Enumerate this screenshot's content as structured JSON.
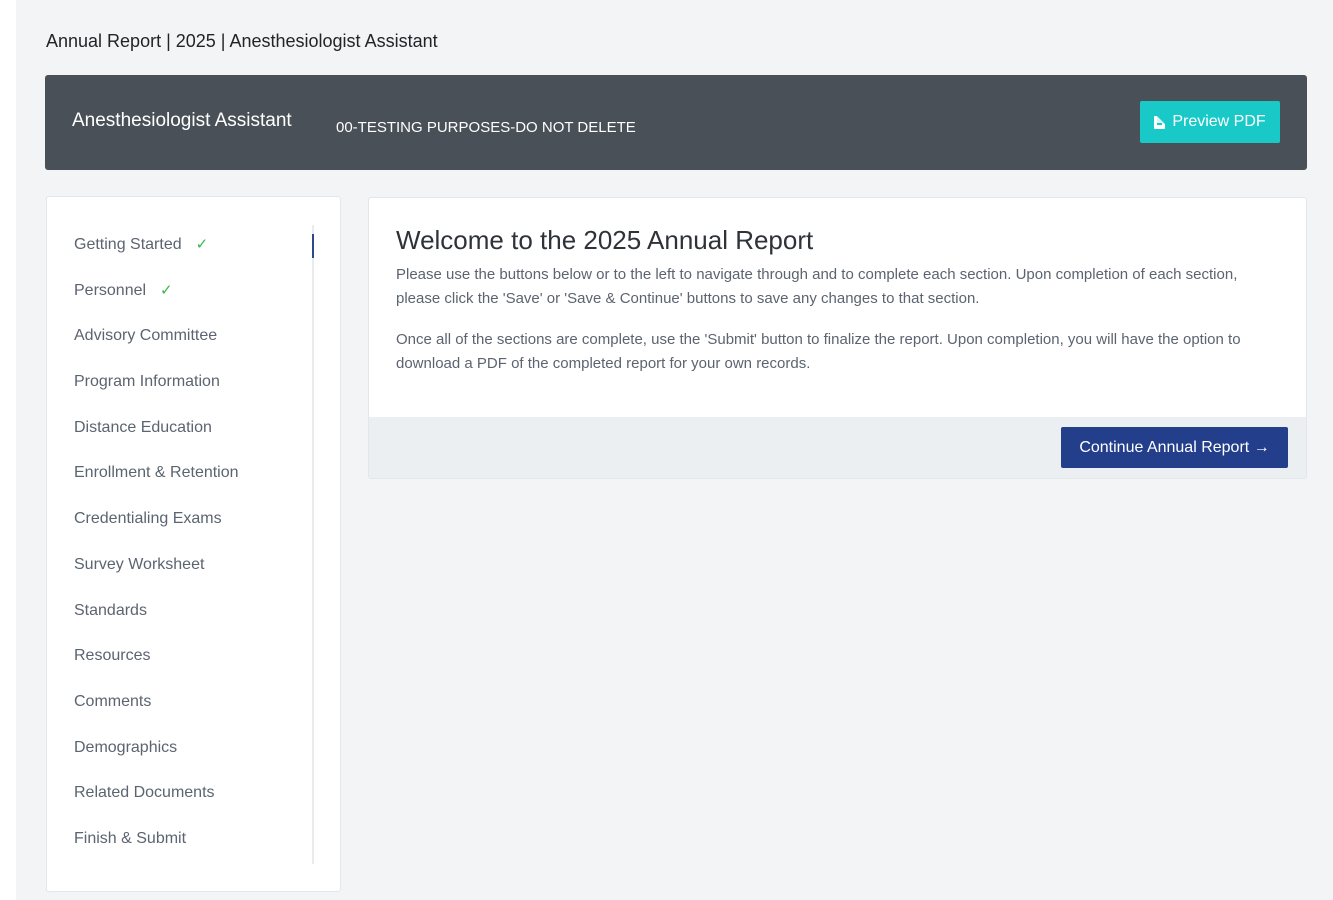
{
  "page": {
    "heading": "Annual Report | 2025 | Anesthesiologist Assistant"
  },
  "program_bar": {
    "name": "Anesthesiologist Assistant",
    "subtitle": "00-TESTING PURPOSES-DO NOT DELETE",
    "preview_button": "Preview PDF",
    "preview_icon": "file-pdf-icon",
    "background_color": "#495057",
    "button_color": "#19c9c7"
  },
  "sidebar": {
    "items": [
      {
        "label": "Getting Started",
        "completed": "✓",
        "active": true
      },
      {
        "label": "Personnel",
        "completed": "✓"
      },
      {
        "label": "Advisory Committee"
      },
      {
        "label": "Program Information"
      },
      {
        "label": "Distance Education"
      },
      {
        "label": "Enrollment & Retention"
      },
      {
        "label": "Credentialing Exams"
      },
      {
        "label": "Survey Worksheet"
      },
      {
        "label": "Standards"
      },
      {
        "label": "Resources"
      },
      {
        "label": "Comments"
      },
      {
        "label": "Demographics"
      },
      {
        "label": "Related Documents"
      },
      {
        "label": "Finish & Submit"
      }
    ],
    "check_color": "#39b54a",
    "active_color": "#2c4a86"
  },
  "welcome_card": {
    "title": "Welcome to the 2025 Annual Report",
    "paragraph_1": "Please use the buttons below or to the left to navigate through and to complete each section. Upon completion of each section, please click the 'Save' or 'Save & Continue' buttons to save any changes to that section.",
    "paragraph_2": "Once all of the sections are complete, use the 'Submit' button to finalize the report. Upon completion, you will have the option to download a PDF of the completed report for your own records.",
    "continue_button": "Continue Annual Report →",
    "button_color": "#233f8c"
  }
}
